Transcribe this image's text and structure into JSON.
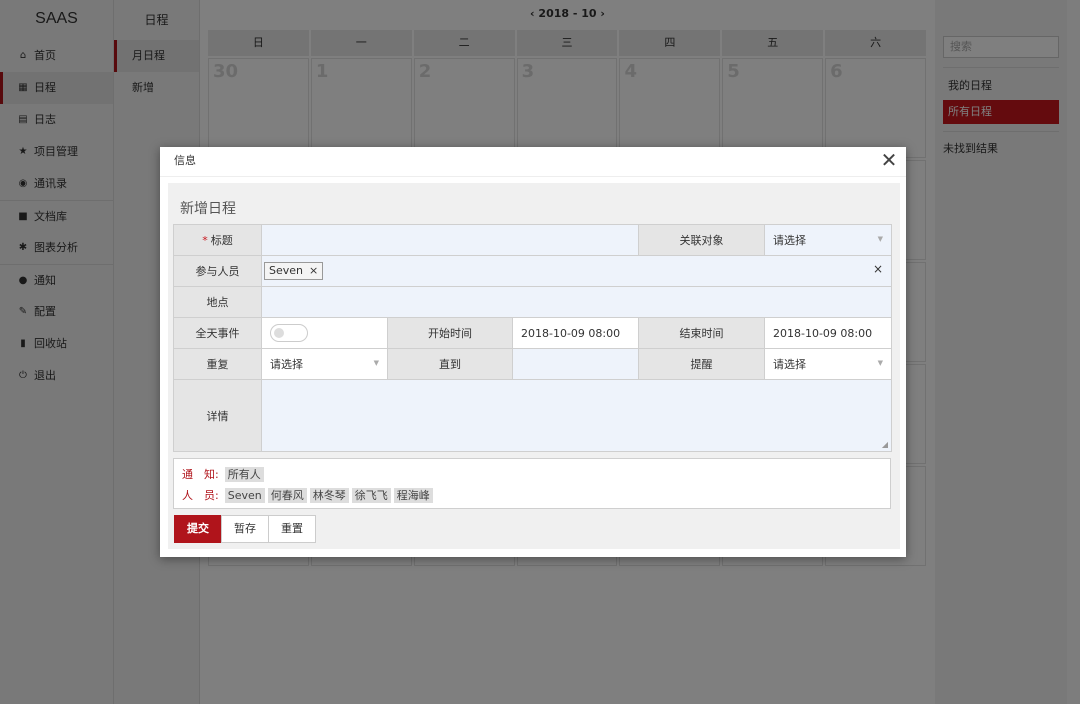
{
  "brand": "SAAS",
  "nav": [
    {
      "label": "首页",
      "icon": "home-icon",
      "glyph": "⌂",
      "active": false
    },
    {
      "label": "日程",
      "icon": "calendar-icon",
      "glyph": "▦",
      "active": true
    },
    {
      "label": "日志",
      "icon": "log-icon",
      "glyph": "▤",
      "active": false
    },
    {
      "label": "项目管理",
      "icon": "star-icon",
      "glyph": "★",
      "active": false
    },
    {
      "label": "通讯录",
      "icon": "contacts-icon",
      "glyph": "◉",
      "active": false
    },
    {
      "label": "文档库",
      "icon": "folder-icon",
      "glyph": "■",
      "active": false
    },
    {
      "label": "图表分析",
      "icon": "chart-icon",
      "glyph": "✱",
      "active": false
    },
    {
      "label": "通知",
      "icon": "bell-icon",
      "glyph": "●",
      "active": false
    },
    {
      "label": "配置",
      "icon": "wrench-icon",
      "glyph": "✎",
      "active": false
    },
    {
      "label": "回收站",
      "icon": "trash-icon",
      "glyph": "▮",
      "active": false
    },
    {
      "label": "退出",
      "icon": "power-icon",
      "glyph": "⏻",
      "active": false
    }
  ],
  "subnav": {
    "title": "日程",
    "items": [
      {
        "label": "月日程",
        "active": true
      },
      {
        "label": "新增",
        "active": false
      }
    ]
  },
  "calendar": {
    "month_label": "2018 - 10",
    "prev_glyph": "‹",
    "next_glyph": "›",
    "weekdays": [
      "日",
      "一",
      "二",
      "三",
      "四",
      "五",
      "六"
    ],
    "first_row": [
      "30",
      "1",
      "2",
      "3",
      "4",
      "5",
      "6"
    ]
  },
  "right": {
    "search_placeholder": "搜索",
    "my_schedule": "我的日程",
    "all_schedule": "所有日程",
    "no_result": "未找到结果"
  },
  "modal": {
    "title": "信息",
    "close": "✕",
    "form_title": "新增日程",
    "labels": {
      "title": "标题",
      "required_mark": "*",
      "related": "关联对象",
      "participants": "参与人员",
      "location": "地点",
      "all_day": "全天事件",
      "start": "开始时间",
      "end": "结束时间",
      "repeat": "重复",
      "until": "直到",
      "remind": "提醒",
      "details": "详情"
    },
    "values": {
      "related": "请选择",
      "participant_tag": "Seven",
      "tag_remove": "×",
      "clear_participants": "×",
      "start": "2018-10-09 08:00",
      "end": "2018-10-09 08:00",
      "repeat": "请选择",
      "remind": "请选择"
    },
    "notify": {
      "label": "通　知:",
      "chips": [
        "所有人"
      ],
      "people_label": "人　员:",
      "people": [
        "Seven",
        "何春风",
        "林冬琴",
        "徐飞飞",
        "程海峰"
      ]
    },
    "buttons": {
      "submit": "提交",
      "save_draft": "暂存",
      "reset": "重置"
    }
  }
}
